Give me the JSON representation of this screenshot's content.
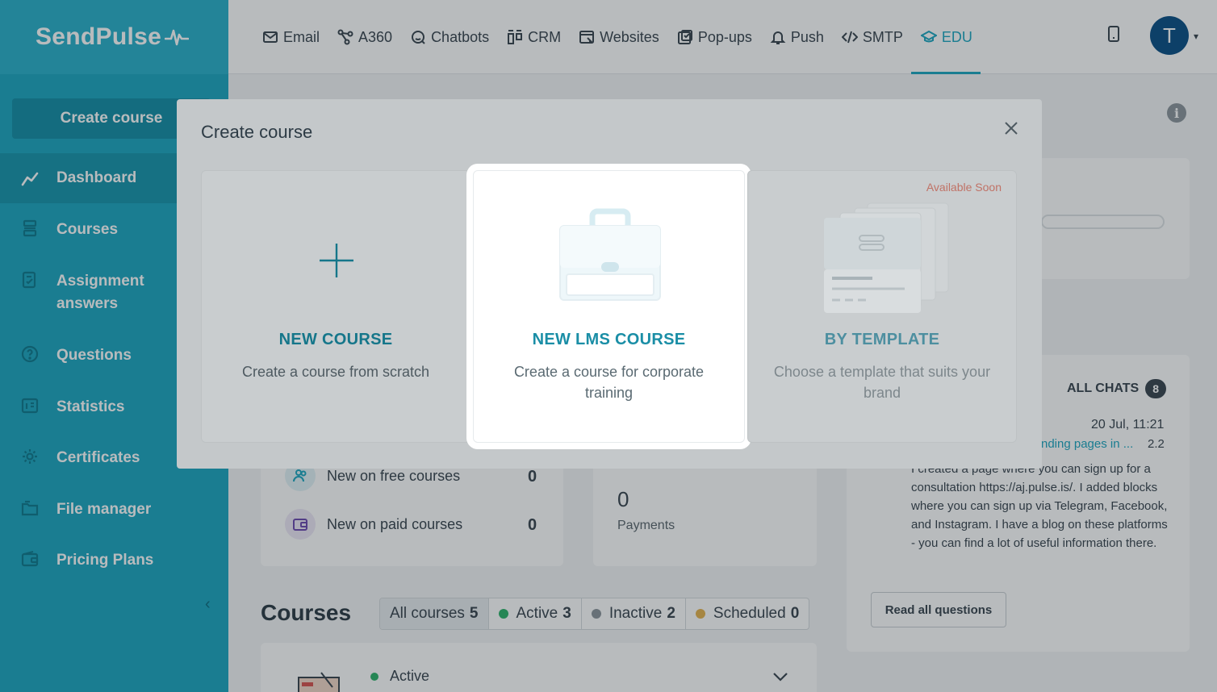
{
  "brand": {
    "logo_text": "SendPulse"
  },
  "sidebar": {
    "create_label": "Create course",
    "items": [
      {
        "label": "Dashboard",
        "icon": "chart-line-icon",
        "active": true
      },
      {
        "label": "Courses",
        "icon": "stack-icon"
      },
      {
        "label": "Assignment answers",
        "icon": "checklist-icon"
      },
      {
        "label": "Questions",
        "icon": "question-icon"
      },
      {
        "label": "Statistics",
        "icon": "stats-icon"
      },
      {
        "label": "Certificates",
        "icon": "gear-icon"
      },
      {
        "label": "File manager",
        "icon": "folder-icon"
      },
      {
        "label": "Pricing Plans",
        "icon": "wallet-icon"
      }
    ],
    "collapse_glyph": "‹"
  },
  "topnav": {
    "items": [
      {
        "label": "Email",
        "icon": "mail-icon"
      },
      {
        "label": "A360",
        "icon": "nodes-icon"
      },
      {
        "label": "Chatbots",
        "icon": "chat-icon"
      },
      {
        "label": "CRM",
        "icon": "kanban-icon"
      },
      {
        "label": "Websites",
        "icon": "website-icon"
      },
      {
        "label": "Pop-ups",
        "icon": "popup-icon"
      },
      {
        "label": "Push",
        "icon": "bell-icon"
      },
      {
        "label": "SMTP",
        "icon": "code-icon"
      },
      {
        "label": "EDU",
        "icon": "graduation-icon",
        "active": true
      }
    ],
    "avatar_letter": "T"
  },
  "modal": {
    "title": "Create course",
    "options": [
      {
        "title": "NEW COURSE",
        "desc": "Create a course from scratch"
      },
      {
        "title": "NEW LMS COURSE",
        "desc": "Create a course for corporate training"
      },
      {
        "title": "BY TEMPLATE",
        "desc": "Choose a template that suits your brand",
        "badge": "Available Soon"
      }
    ]
  },
  "stats": {
    "free": {
      "label": "New on free courses",
      "value": "0"
    },
    "paid": {
      "label": "New on paid courses",
      "value": "0"
    },
    "payments": {
      "value": "0",
      "label": "Payments"
    }
  },
  "chats": {
    "header": "ALL CHATS",
    "count": "8",
    "time": "20 Jul, 11:21",
    "link": "nding pages in ...",
    "link_count": "2.2",
    "text": "I created a page where you can sign up for a consultation https://aj.pulse.is/. I added blocks where you can sign up via Telegram, Facebook, and Instagram. I have a blog on these platforms - you can find a lot of useful information there.",
    "read_all": "Read all questions"
  },
  "courses": {
    "title": "Courses",
    "filters": [
      {
        "label": "All courses",
        "count": "5",
        "selected": true
      },
      {
        "label": "Active",
        "count": "3",
        "color": "#2fb36b"
      },
      {
        "label": "Inactive",
        "count": "2",
        "color": "#8d969c"
      },
      {
        "label": "Scheduled",
        "count": "0",
        "color": "#e6b450"
      }
    ],
    "first_status": "Active"
  },
  "colors": {
    "accent": "#1ea6c0",
    "sidebar": "#1ea6c0",
    "avatar": "#0b4f86"
  }
}
